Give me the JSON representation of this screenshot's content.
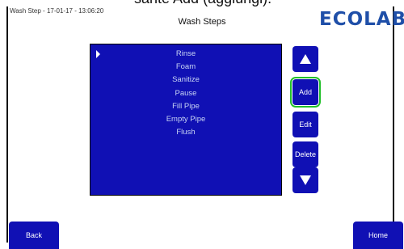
{
  "caption_fragment": "sante Add (aggiungi).",
  "header": {
    "stamp": "Wash Step - 17-01-17 - 13:06:20",
    "title": "Wash Steps",
    "logo": "ECOLAB"
  },
  "steps": [
    "Rinse",
    "Foam",
    "Sanitize",
    "Pause",
    "Fill Pipe",
    "Empty Pipe",
    "Flush"
  ],
  "selected_index": 0,
  "side_buttons": {
    "up_icon": "arrow-up-icon",
    "add": "Add",
    "edit": "Edit",
    "delete": "Delete",
    "down_icon": "arrow-down-icon"
  },
  "nav": {
    "back": "Back",
    "home": "Home"
  },
  "colors": {
    "panel": "#1010b4",
    "button": "#1010b4",
    "focus": "#22c02a",
    "logo": "#1f4fa8"
  }
}
